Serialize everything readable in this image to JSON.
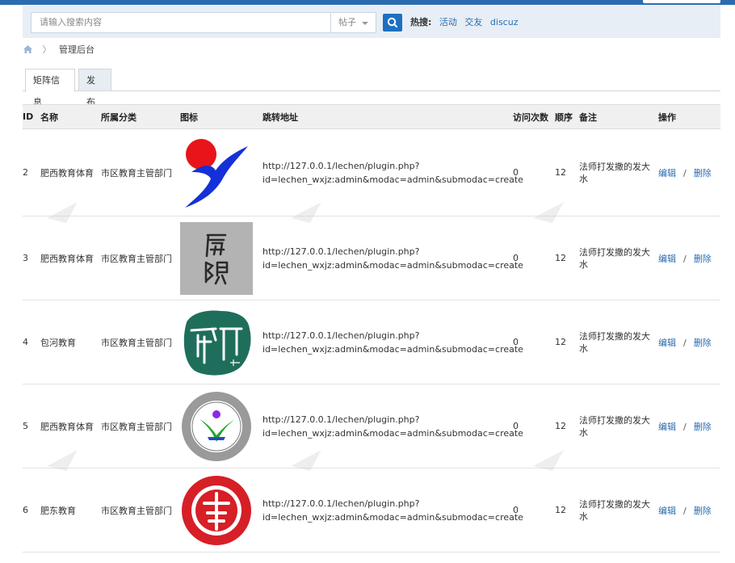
{
  "search": {
    "placeholder": "请输入搜索内容",
    "type_selected": "帖子",
    "hot_label": "热搜:",
    "hot_links": [
      "活动",
      "交友",
      "discuz"
    ]
  },
  "breadcrumb": {
    "current": "管理后台"
  },
  "tabs": [
    "矩阵信息",
    "发布"
  ],
  "table": {
    "headers": [
      "ID",
      "名称",
      "所属分类",
      "图标",
      "跳转地址",
      "访问次数",
      "顺序",
      "备注",
      "操作"
    ],
    "rows": [
      {
        "id": "2",
        "name": "肥西教育体育",
        "category": "市区教育主管部门",
        "icon": "blue-red-figure-logo-icon",
        "url_line1": "http://127.0.0.1/lechen/plugin.php?",
        "url_line2": "id=lechen_wxjz:admin&modac=admin&submodac=create",
        "visits": "0",
        "order": "12",
        "note": "法师打发撒的发大水",
        "edit": "编辑",
        "delete": "删除"
      },
      {
        "id": "3",
        "name": "肥西教育体育",
        "category": "市区教育主管部门",
        "icon": "calligraphy-seal-icon",
        "url_line1": "http://127.0.0.1/lechen/plugin.php?",
        "url_line2": "id=lechen_wxjz:admin&modac=admin&submodac=create",
        "visits": "0",
        "order": "12",
        "note": "法师打发撒的发大水",
        "edit": "编辑",
        "delete": "删除"
      },
      {
        "id": "4",
        "name": "包河教育",
        "category": "市区教育主管部门",
        "icon": "green-stone-seal-icon",
        "url_line1": "http://127.0.0.1/lechen/plugin.php?",
        "url_line2": "id=lechen_wxjz:admin&modac=admin&submodac=create",
        "visits": "0",
        "order": "12",
        "note": "法师打发撒的发大水",
        "edit": "编辑",
        "delete": "删除"
      },
      {
        "id": "5",
        "name": "肥西教育体育",
        "category": "市区教育主管部门",
        "icon": "hefei-school-round-emblem-icon",
        "url_line1": "http://127.0.0.1/lechen/plugin.php?",
        "url_line2": "id=lechen_wxjz:admin&modac=admin&submodac=create",
        "visits": "0",
        "order": "12",
        "note": "法师打发撒的发大水",
        "edit": "编辑",
        "delete": "删除"
      },
      {
        "id": "6",
        "name": "肥东教育",
        "category": "市区教育主管部门",
        "icon": "red-school-round-emblem-icon",
        "url_line1": "http://127.0.0.1/lechen/plugin.php?",
        "url_line2": "id=lechen_wxjz:admin&modac=admin&submodac=create",
        "visits": "0",
        "order": "12",
        "note": "法师打发撒的发大水",
        "edit": "编辑",
        "delete": "删除"
      }
    ]
  },
  "colors": {
    "link": "#2b6cb0",
    "search_button": "#1f6fbf",
    "searchbar_bg": "#e7eef6"
  }
}
